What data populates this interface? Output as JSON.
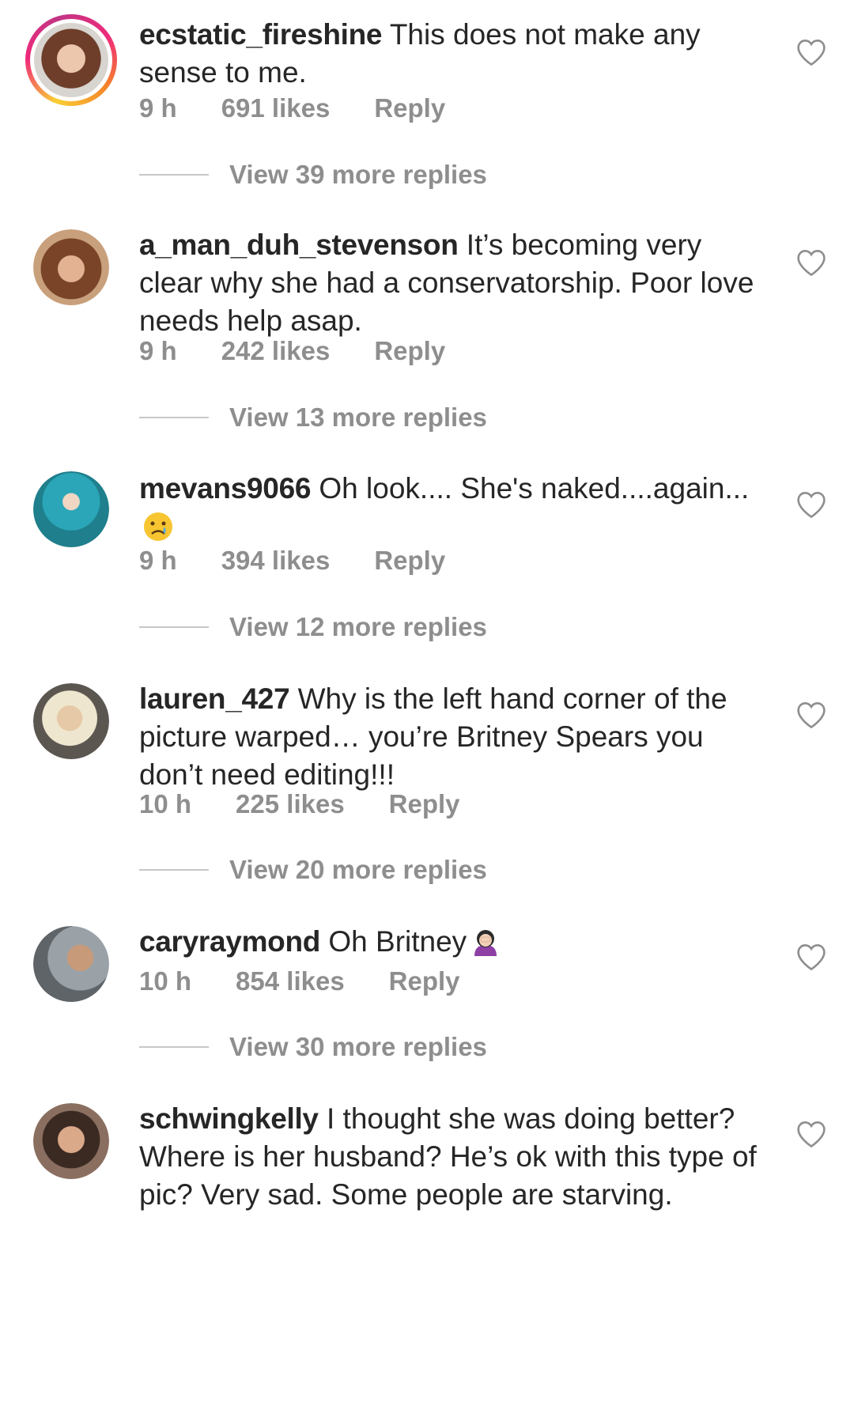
{
  "comments": [
    {
      "username": "ecstatic_fireshine",
      "text": " This does not make any sense to me.",
      "time": "9 h",
      "likes": "691 likes",
      "reply": "Reply",
      "view_replies": "View 39 more replies",
      "avatar_colors": [
        "#7a4a36",
        "#e9c1a8"
      ]
    },
    {
      "username": "a_man_duh_stevenson",
      "text": " It’s becoming very clear why she had a conservatorship. Poor love needs help asap.",
      "time": "9 h",
      "likes": "242 likes",
      "reply": "Reply",
      "view_replies": "View 13 more replies",
      "avatar_colors": [
        "#6b3a25",
        "#d7a27f"
      ]
    },
    {
      "username": "mevans9066",
      "text": " Oh look.... She's naked....again...",
      "emoji": "crying-face-emoji",
      "time": "9 h",
      "likes": "394 likes",
      "reply": "Reply",
      "view_replies": "View 12 more replies",
      "avatar_colors": [
        "#2aa6b8",
        "#f0d7c4"
      ]
    },
    {
      "username": "lauren_427",
      "text": " Why is the left hand corner of the picture warped… you’re Britney Spears you don’t need editing!!!",
      "time": "10 h",
      "likes": "225 likes",
      "reply": "Reply",
      "view_replies": "View 20 more replies",
      "avatar_colors": [
        "#d9d1c4",
        "#e6c9a6"
      ]
    },
    {
      "username": "caryraymond",
      "text": " Oh Britney",
      "emoji": "facepalm-woman-emoji",
      "time": "10 h",
      "likes": "854 likes",
      "reply": "Reply",
      "view_replies": "View 30 more replies",
      "avatar_colors": [
        "#9aa2a8",
        "#c79a7a"
      ]
    },
    {
      "username": "schwingkelly",
      "text": " I thought she was doing better?  Where is her husband?  He’s ok with this type of pic? Very sad.  Some people are starving.",
      "avatar_colors": [
        "#3b2a22",
        "#d9a98a"
      ]
    }
  ]
}
